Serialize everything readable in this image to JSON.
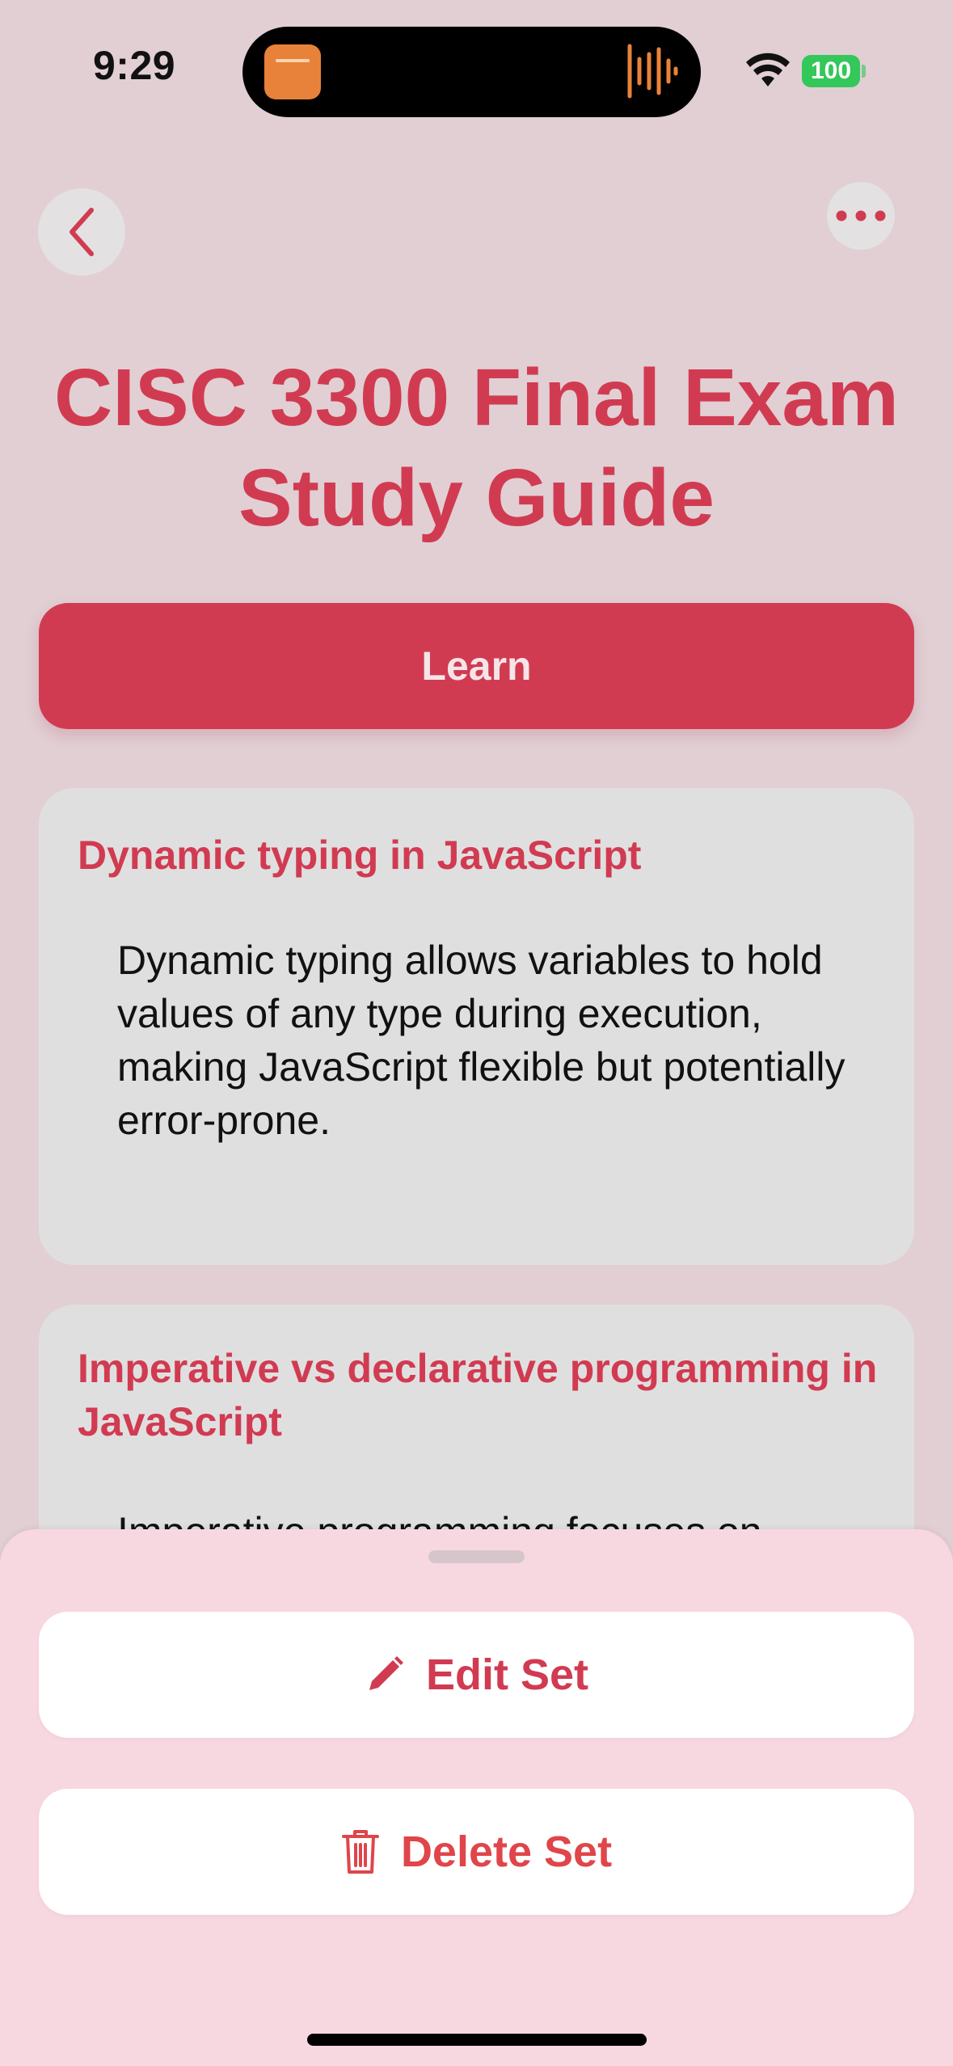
{
  "status_bar": {
    "time": "9:29",
    "battery": "100"
  },
  "nav": {
    "back_icon": "chevron-left-icon",
    "more_icon": "ellipsis-icon"
  },
  "set_title": "CISC 3300 Final Exam Study Guide",
  "learn_button": "Learn",
  "cards": [
    {
      "term": "Dynamic typing in JavaScript",
      "definition": "Dynamic typing allows variables to hold values of any type during execution, making JavaScript flexible but potentially error-prone."
    },
    {
      "term": "Imperative vs declarative programming in JavaScript",
      "definition": "Imperative programming focuses on"
    }
  ],
  "sheet": {
    "edit_label": "Edit Set",
    "edit_icon": "pencil-icon",
    "delete_label": "Delete Set",
    "delete_icon": "trash-icon"
  },
  "colors": {
    "accent": "#d13b51",
    "destructive": "#e0454a",
    "background": "#e1cfd4",
    "sheet": "#f8d8e0"
  }
}
